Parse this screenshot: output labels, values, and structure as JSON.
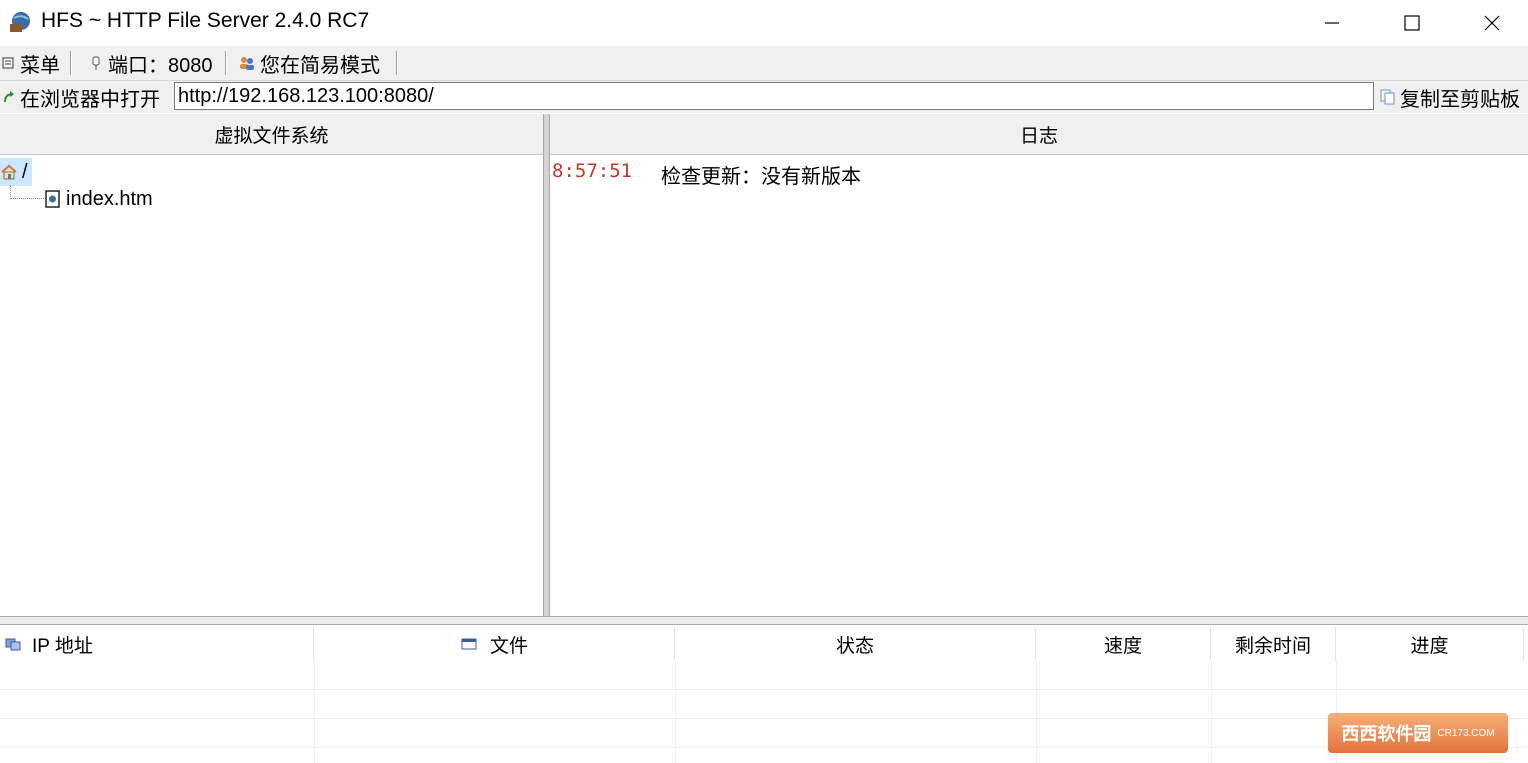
{
  "window": {
    "title": "HFS ~ HTTP File Server 2.4.0 RC7",
    "icons": {
      "app": "hfs-globe-icon",
      "minimize": "minimize-icon",
      "maximize": "maximize-icon",
      "close": "close-icon"
    }
  },
  "toolbar": {
    "menu_label": "菜单",
    "port_label": "端口：8080",
    "mode_label": "您在简易模式"
  },
  "urlbar": {
    "open_label": "在浏览器中打开",
    "url_value": "http://192.168.123.100:8080/",
    "copy_label": "复制至剪贴板"
  },
  "vfs": {
    "header": "虚拟文件系统",
    "root": "/",
    "items": [
      {
        "name": "index.htm"
      }
    ]
  },
  "log": {
    "header": "日志",
    "entries": [
      {
        "time": "8:57:51",
        "message": "检查更新：没有新版本"
      }
    ]
  },
  "connections": {
    "columns": [
      "IP 地址",
      "文件",
      "状态",
      "速度",
      "剩余时间",
      "进度"
    ]
  },
  "watermark": {
    "text": "西西软件园",
    "sub": "CR173.COM"
  }
}
